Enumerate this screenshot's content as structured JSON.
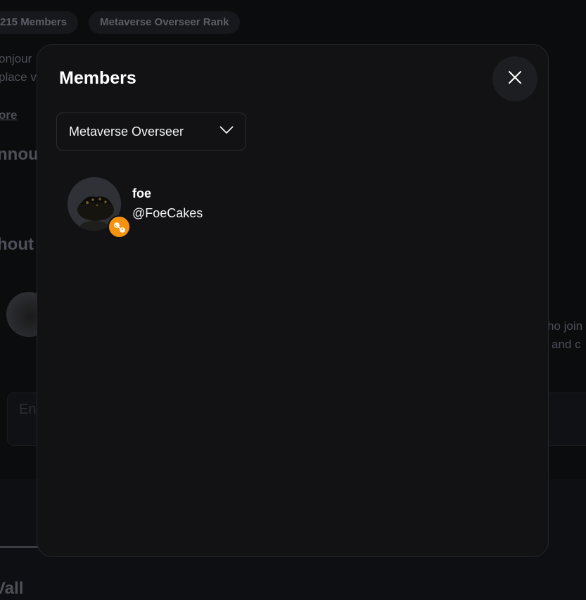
{
  "background": {
    "chips": [
      "215 Members",
      "Metaverse Overseer Rank"
    ],
    "description_fragments": [
      "onjour",
      "place v"
    ],
    "read_more_link": "ore",
    "announcements_heading": "nnou",
    "shouts_heading": "hout",
    "shout_text_fragments": [
      "ho join",
      "and c"
    ],
    "input_placeholder": "En",
    "wall_heading": "Vall"
  },
  "modal": {
    "title": "Members",
    "close_icon": "close-icon",
    "role_select": {
      "selected": "Metaverse Overseer",
      "icon": "chevron-down-icon"
    },
    "members": [
      {
        "display_name": "foe",
        "username": "@FoeCakes",
        "badge_icon": "wrench-icon",
        "badge_color": "#f5930f"
      }
    ]
  }
}
